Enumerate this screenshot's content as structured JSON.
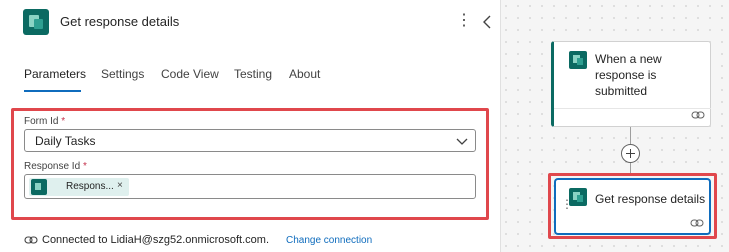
{
  "panel": {
    "title": "Get response details",
    "icon": "forms-icon",
    "more_icon": "more-vertical-icon",
    "collapse_icon": "chevron-left-icon"
  },
  "tabs": [
    {
      "label": "Parameters",
      "active": true
    },
    {
      "label": "Settings",
      "active": false
    },
    {
      "label": "Code View",
      "active": false
    },
    {
      "label": "Testing",
      "active": false
    },
    {
      "label": "About",
      "active": false
    }
  ],
  "fields": {
    "form_id": {
      "label": "Form Id",
      "required_mark": "*",
      "value": "Daily Tasks"
    },
    "response_id": {
      "label": "Response Id",
      "required_mark": "*",
      "token_label": "Respons...",
      "token_close": "×"
    }
  },
  "connection": {
    "text": "Connected to LidiaH@szg52.onmicrosoft.com.",
    "link": "Change connection"
  },
  "canvas": {
    "trigger_card": {
      "title": "When a new response is submitted"
    },
    "action_card": {
      "title": "Get response details"
    }
  },
  "colors": {
    "accent": "#0f6cbd",
    "highlight": "#e0474c",
    "forms_brand": "#0b6a62"
  }
}
